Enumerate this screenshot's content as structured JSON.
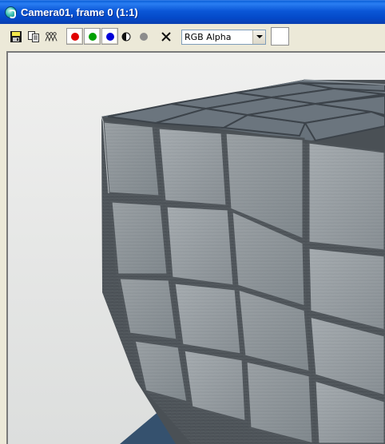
{
  "window": {
    "title": "Camera01, frame 0 (1:1)",
    "app_icon": "3ds-max-icon"
  },
  "toolbar": {
    "save_icon": "save-image-icon",
    "copy_icon": "copy-image-icon",
    "clone_icon": "clone-window-icon",
    "channels": [
      {
        "name": "red-channel",
        "color": "#e00000"
      },
      {
        "name": "green-channel",
        "color": "#00a000"
      },
      {
        "name": "blue-channel",
        "color": "#0000d8"
      }
    ],
    "monochrome_icon": "monochrome-icon",
    "alpha_dot_color": "#8c8c8c",
    "clear_icon": "clear-x-icon",
    "channel_select": {
      "selected": "RGB Alpha"
    },
    "swatch_color": "#ffffff"
  },
  "render": {
    "description_colors": {
      "background": "#e7e8e8",
      "tile_face": "#8d9499",
      "tile_top": "#626c75",
      "ground_blue": "#35516e"
    }
  }
}
